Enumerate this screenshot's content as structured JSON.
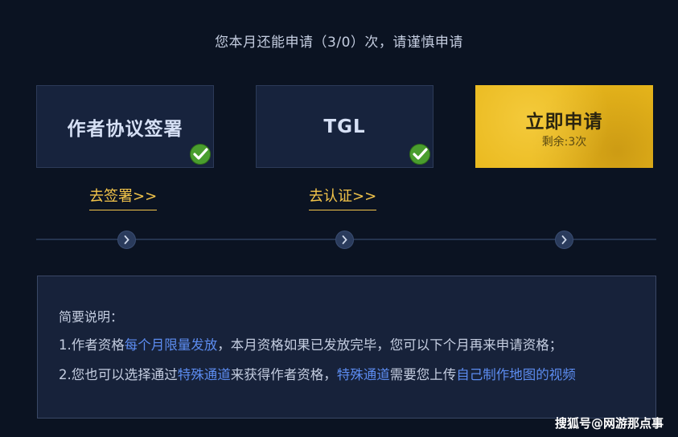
{
  "notice": "您本月还能申请（3/0）次，请谨慎申请",
  "cards": [
    {
      "title": "作者协议签署",
      "completed": true,
      "link": "去签署>>"
    },
    {
      "title": "TGL",
      "completed": true,
      "link": "去认证>>"
    },
    {
      "title": "立即申请",
      "sub": "剩余:3次",
      "accent": "#e9b81c"
    }
  ],
  "info": {
    "heading": "简要说明：",
    "line1": {
      "prefix": "1.作者资格",
      "highlight": "每个月限量发放",
      "suffix": "，本月资格如果已发放完毕，您可以下个月再来申请资格；"
    },
    "line2": {
      "prefix": "2.您也可以选择通过",
      "highlight1": "特殊通道",
      "mid1": "来获得作者资格，",
      "highlight2": "特殊通道",
      "mid2": "需要您上传",
      "highlight3": "自己制作地图的视频"
    }
  },
  "watermark": "搜狐号@网游那点事",
  "colors": {
    "background": "#0b1322",
    "link": "#f3c44a",
    "highlight": "#5c8cf0",
    "check": "#4a9e2e"
  }
}
